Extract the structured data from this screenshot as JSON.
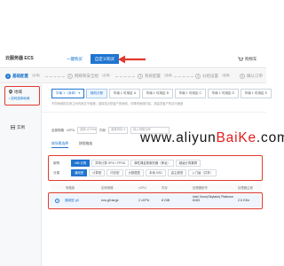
{
  "header": {
    "title": "云服务器 ECS",
    "tab_quick": "一键购买",
    "tab_custom": "自定义购买",
    "cart_label": "购物车"
  },
  "steps": [
    {
      "num": "1",
      "label": "基础配置",
      "sub": "（必填）"
    },
    {
      "num": "2",
      "label": "网络和安全组",
      "sub": "（必填）"
    },
    {
      "num": "3",
      "label": "系统配置",
      "sub": "（选填）"
    },
    {
      "num": "4",
      "label": "分组设置",
      "sub": "（选填）"
    },
    {
      "num": "5",
      "label": "确认订单",
      "sub": ""
    }
  ],
  "sidebar": {
    "region_label": "地域",
    "region_link": "如何选择地域",
    "instance_label": "实例"
  },
  "region": {
    "selected": "华南 1（深圳）",
    "random_zone": "随机分配",
    "zones": [
      "华南 1 可用区 A",
      "华南 1 可用区 B",
      "华南 1 可用区 C",
      "华南 1 可用区 D",
      "华南 1 可用区 E",
      "华南 1"
    ],
    "hint": "不同地域的实例之间内网互不相通；选择靠近您客户的地域，可降低网络时延、提高您客户的访问速度"
  },
  "filters": {
    "vcpu_label": "vCPU",
    "vcpu_placeholder": "选择 vCPU",
    "memory_label": "内存",
    "memory_placeholder": "选择内存",
    "search_placeholder": "输入规格名称",
    "all_specs_label": "全部规格"
  },
  "watermark": {
    "prefix": "www.aliyun",
    "brand": "BaiKe",
    "suffix": ".com"
  },
  "subtabs": {
    "by_scenario": "按场景选择",
    "by_family": "按规格族"
  },
  "architecture": {
    "arch_label": "架构",
    "arch_options": [
      "x86 计算",
      "异构计算 GPU / FPGA",
      "弹性裸金属服务器（神龙）",
      "超级计算集群"
    ],
    "arch_selected": 0,
    "category_label": "分类",
    "category_options": [
      "通用型",
      "计算型",
      "内存型",
      "大数据型",
      "本地 SSD",
      "高主频型",
      "入门级（共享）"
    ],
    "category_selected": 0
  },
  "table": {
    "headers": [
      "规格族",
      "实例规格",
      "vCPU",
      "内存",
      "处理器型号",
      "处理器主频"
    ],
    "rows": [
      {
        "family": "通用型 g5",
        "spec": "ecs.g5.large",
        "vcpu": "2 vCPU",
        "memory": "8 GiB",
        "cpu_model": "Intel Xeon(Skylake) Platinum 8163",
        "clock": "2.5 GHz"
      }
    ]
  },
  "colors": {
    "accent": "#1f75d0",
    "highlight_box": "#e23a2e",
    "watermark_brand": "#e21c1c"
  }
}
